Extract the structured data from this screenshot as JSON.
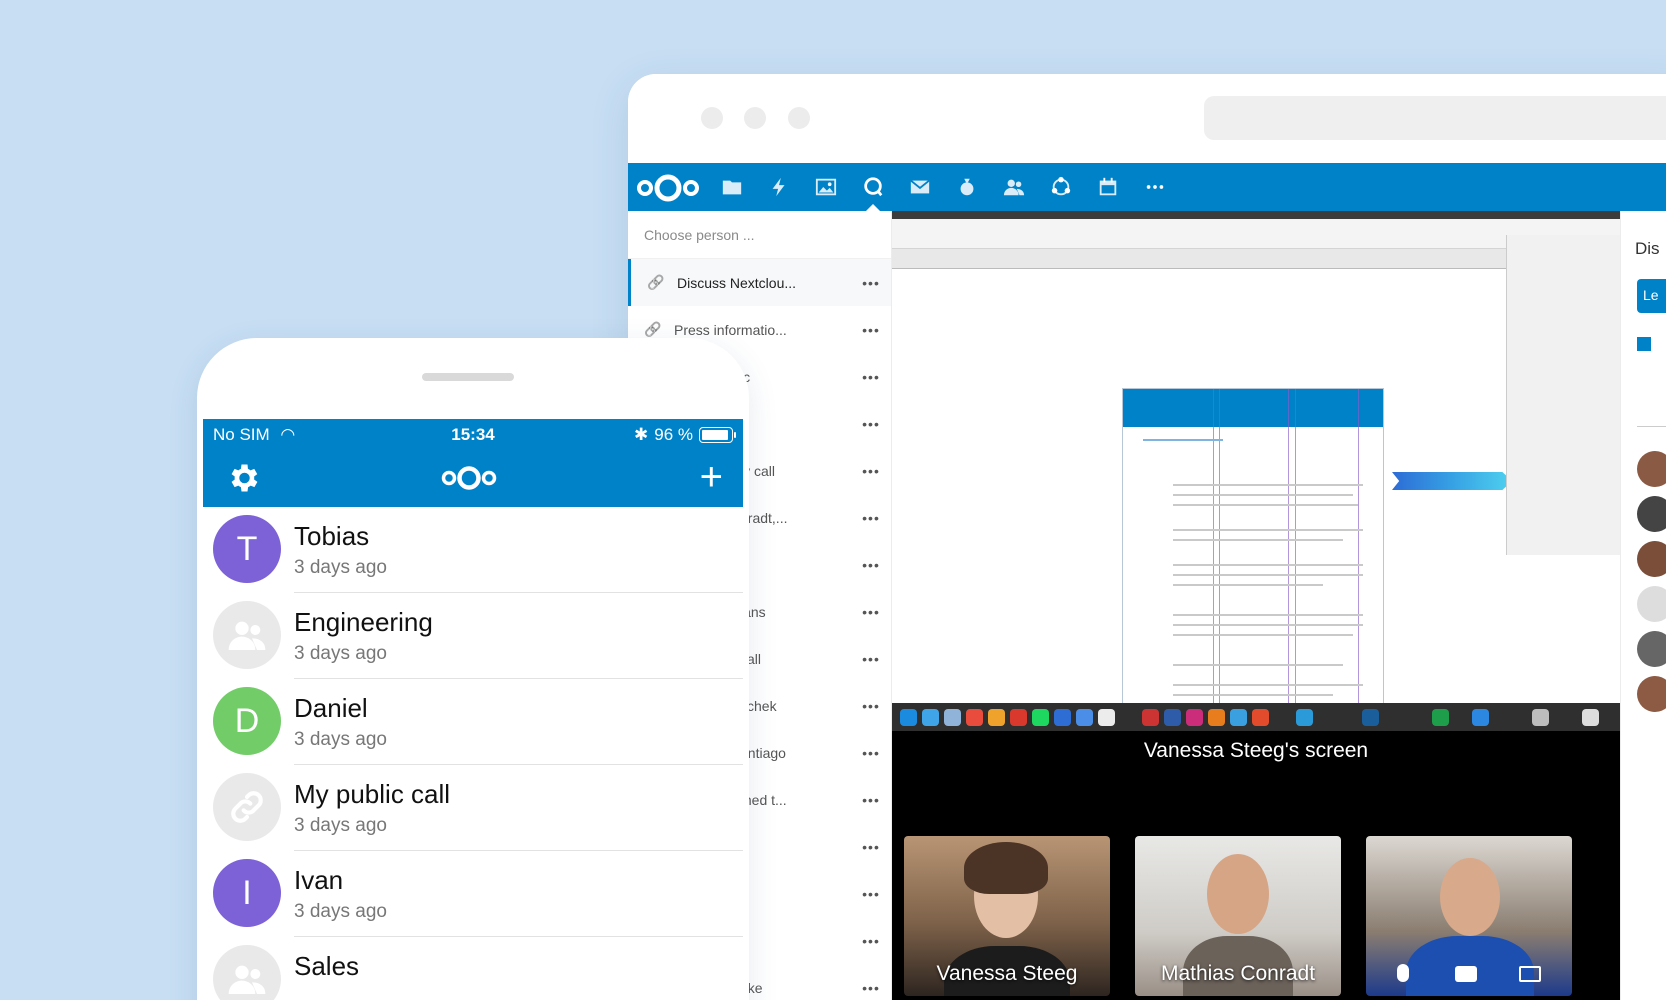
{
  "colors": {
    "brand": "#0082c9",
    "background": "#c7def3",
    "avatar_purple": "#7c62d6",
    "avatar_green": "#72cc68",
    "avatar_grey": "#e9e9e9"
  },
  "browser": {
    "header_icons": [
      "files-icon",
      "activity-icon",
      "gallery-icon",
      "talk-icon",
      "mail-icon",
      "budget-icon",
      "contacts-icon",
      "circles-icon",
      "calendar-icon",
      "more-apps-icon"
    ],
    "person_placeholder": "Choose person ...",
    "conversations": [
      {
        "label": "Discuss Nextclou...",
        "more": "•••"
      },
      {
        "label": "Press informatio...",
        "more": "•••"
      },
      {
        "label": "ic",
        "more": "•••"
      },
      {
        "label": "",
        "more": "•••"
      },
      {
        "label": "ly call",
        "more": "•••"
      },
      {
        "label": "nradt,...",
        "more": "•••"
      },
      {
        "label": "",
        "more": "•••"
      },
      {
        "label": "lans",
        "more": "•••"
      },
      {
        "label": "call",
        "more": "•••"
      },
      {
        "label": "schek",
        "more": "•••"
      },
      {
        "label": "antiago",
        "more": "•••"
      },
      {
        "label": "med t...",
        "more": "•••"
      },
      {
        "label": "",
        "more": "•••"
      },
      {
        "label": "",
        "more": "•••"
      },
      {
        "label": "",
        "more": "•••"
      },
      {
        "label": "nke",
        "more": "•••"
      }
    ],
    "screen_share_label": "Vanessa Steeg's screen",
    "participants": [
      "Vanessa Steeg",
      "Mathias Conradt",
      ""
    ],
    "right_panel": {
      "title": "Dis",
      "button": "Le"
    }
  },
  "phone": {
    "carrier": "No SIM",
    "time": "15:34",
    "battery": "96 %",
    "rows": [
      {
        "name": "Tobias",
        "sub": "3 days ago",
        "initial": "T"
      },
      {
        "name": "Engineering",
        "sub": "3 days ago",
        "initial": ""
      },
      {
        "name": "Daniel",
        "sub": "3 days ago",
        "initial": "D"
      },
      {
        "name": "My public call",
        "sub": "3 days ago",
        "initial": ""
      },
      {
        "name": "Ivan",
        "sub": "3 days ago",
        "initial": "I"
      },
      {
        "name": "Sales",
        "sub": "",
        "initial": ""
      }
    ]
  }
}
